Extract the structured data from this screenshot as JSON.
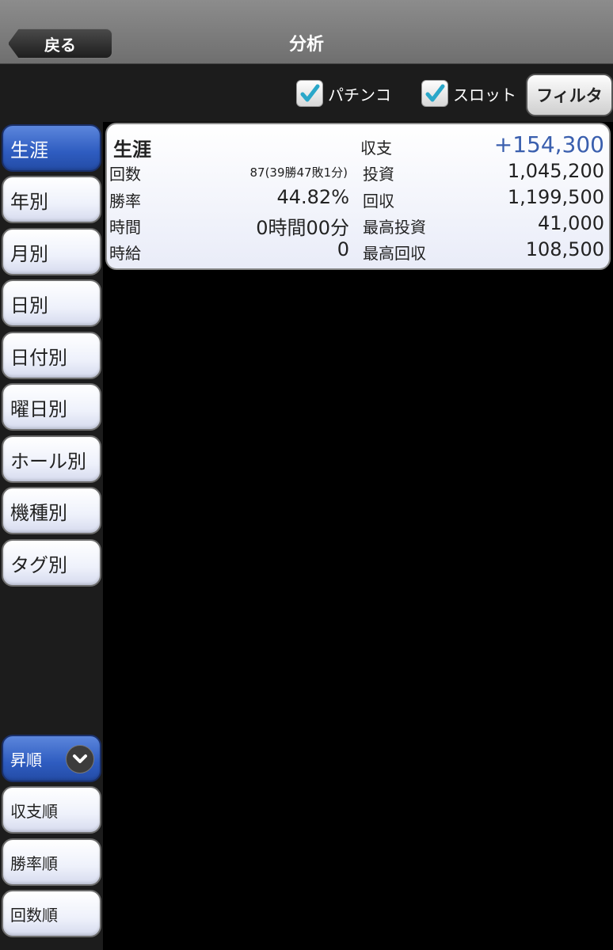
{
  "nav": {
    "back_label": "戻る",
    "title": "分析"
  },
  "filters": {
    "pachinko": {
      "label": "パチンコ",
      "checked": true
    },
    "slot": {
      "label": "スロット",
      "checked": true
    },
    "filter_button": "フィルタ"
  },
  "sidebar": {
    "items": [
      {
        "label": "生涯",
        "selected": true
      },
      {
        "label": "年別"
      },
      {
        "label": "月別"
      },
      {
        "label": "日別"
      },
      {
        "label": "日付別"
      },
      {
        "label": "曜日別"
      },
      {
        "label": "ホール別"
      },
      {
        "label": "機種別"
      },
      {
        "label": "タグ別"
      }
    ],
    "sort": {
      "order_label": "昇順",
      "items": [
        {
          "label": "収支順"
        },
        {
          "label": "勝率順"
        },
        {
          "label": "回数順"
        }
      ]
    }
  },
  "summary": {
    "title": "生涯",
    "balance_label": "収支",
    "balance_value": "+154,300",
    "balance_color": "#3a5fae",
    "count_label": "回数",
    "count_value": "87(39勝47敗1分)",
    "win_rate_label": "勝率",
    "win_rate_value": "44.82%",
    "time_label": "時間",
    "time_value": "0時間00分",
    "hourly_label": "時給",
    "hourly_value": "0",
    "investment_label": "投資",
    "investment_value": "1,045,200",
    "recovery_label": "回収",
    "recovery_value": "1,199,500",
    "max_investment_label": "最高投資",
    "max_investment_value": "41,000",
    "max_recovery_label": "最高回収",
    "max_recovery_value": "108,500"
  }
}
